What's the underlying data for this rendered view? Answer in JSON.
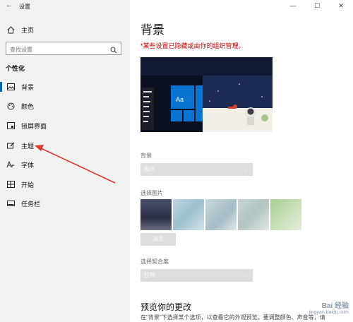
{
  "window": {
    "title": "设置",
    "controls": [
      "—",
      "☐",
      "✕"
    ]
  },
  "sidebar": {
    "home_label": "主页",
    "search": {
      "placeholder": "查找设置"
    },
    "section_title": "个性化",
    "items": [
      {
        "label": "背景",
        "icon": "image-icon",
        "selected": true
      },
      {
        "label": "颜色",
        "icon": "palette-icon"
      },
      {
        "label": "锁屏界面",
        "icon": "lock-screen-icon"
      },
      {
        "label": "主题",
        "icon": "theme-icon"
      },
      {
        "label": "字体",
        "icon": "font-icon"
      },
      {
        "label": "开始",
        "icon": "start-icon"
      },
      {
        "label": "任务栏",
        "icon": "taskbar-icon"
      }
    ]
  },
  "main": {
    "title": "背景",
    "warning": "*某些设置已隐藏或由你的组织管理。",
    "preview": {
      "sample_text": "Aa"
    },
    "background": {
      "label": "背景",
      "value": "图片"
    },
    "choose_picture": {
      "label": "选择图片",
      "browse_label": "浏览"
    },
    "fit": {
      "label": "选择契合度",
      "value": "拉伸"
    },
    "preview_heading": "预览你的更改",
    "preview_hint": "在\"背景\"下选择某个选项，以查看它的外观预览。要调整颜色、声音等，请"
  },
  "colors": {
    "accent": "#0063b1",
    "warning": "#c50500",
    "annotation": "#e0352b"
  },
  "watermark": {
    "text": "Bai 经验",
    "sub": "jingyan.baidu.com"
  }
}
